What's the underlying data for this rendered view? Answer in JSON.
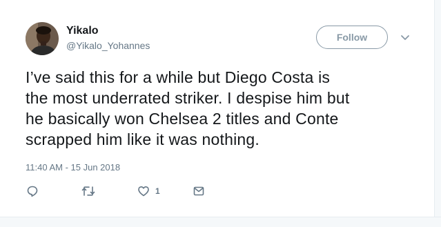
{
  "tweet": {
    "author": {
      "display_name": "Yikalo",
      "handle": "@Yikalo_Yohannes"
    },
    "follow_label": "Follow",
    "lines": [
      "I’ve said this for a while but Diego Costa is",
      "the most underrated striker. I despise him but",
      "he basically won Chelsea 2 titles and Conte",
      "scrapped him like it was nothing."
    ],
    "timestamp": "11:40 AM - 15 Jun 2018",
    "actions": {
      "reply_icon": "reply-icon",
      "retweet_icon": "retweet-icon",
      "like_icon": "heart-icon",
      "like_count": "1",
      "dm_icon": "envelope-icon"
    }
  },
  "colors": {
    "text": "#14171a",
    "secondary": "#657786",
    "follow_border": "#8899a6"
  }
}
